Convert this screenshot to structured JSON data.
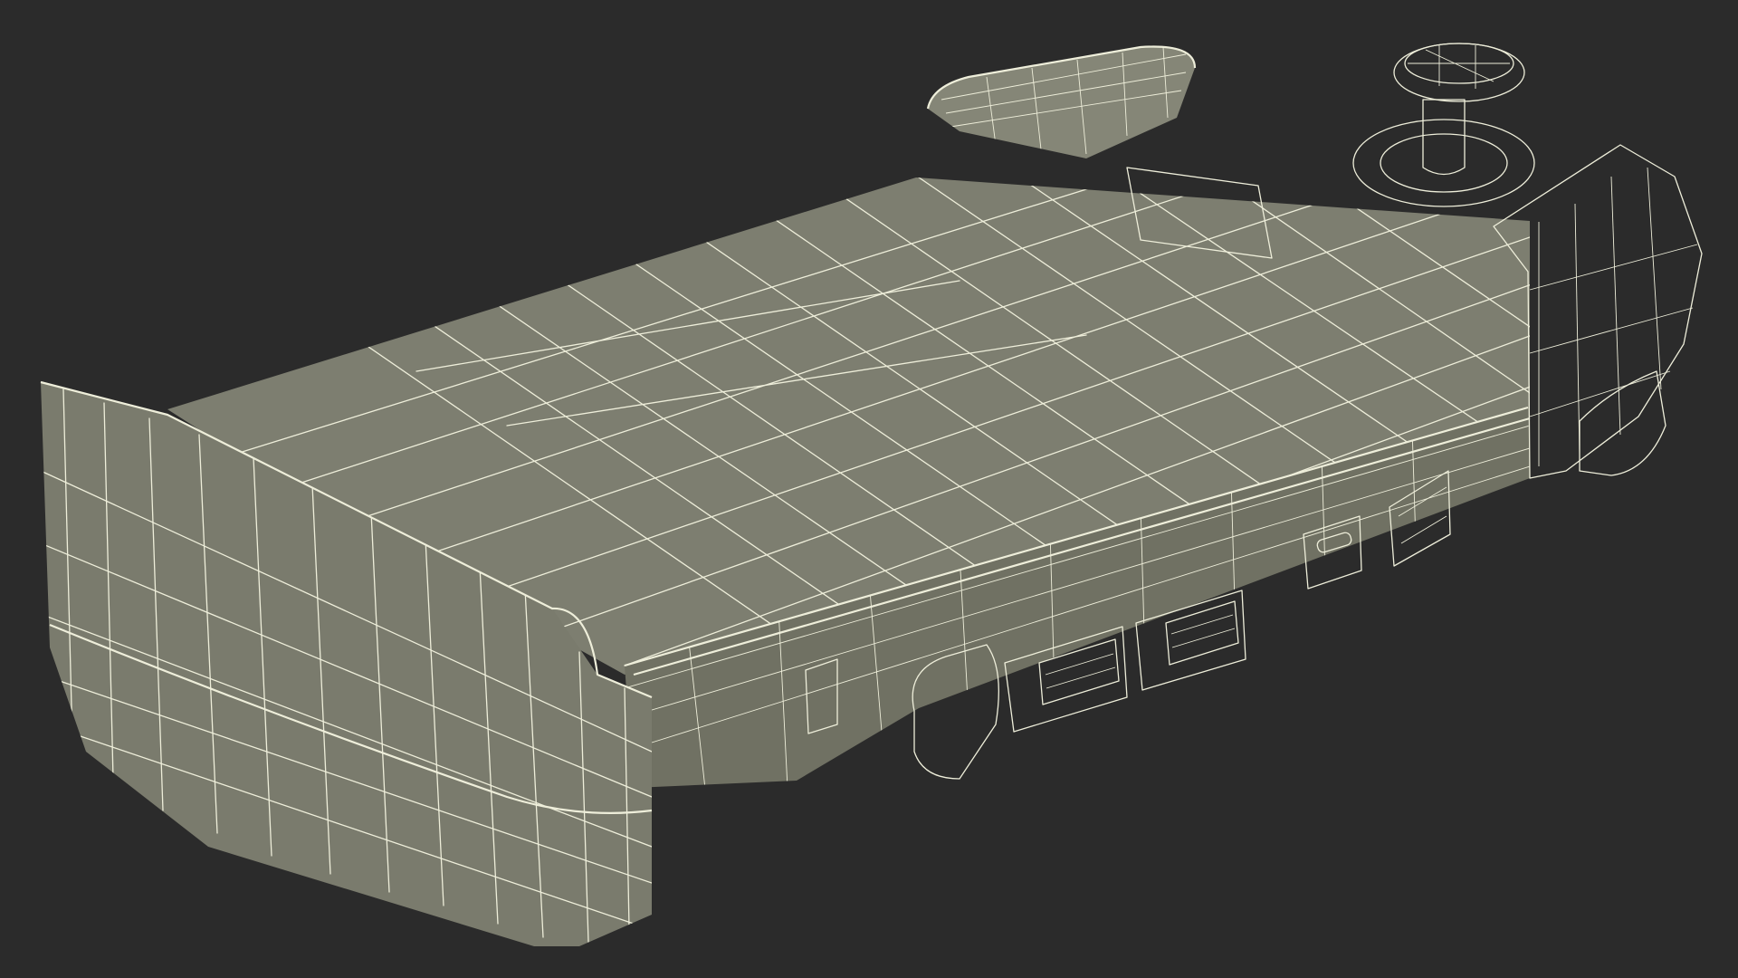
{
  "colors": {
    "background": "#2b2b2b",
    "mesh_fill": "#7d7e70",
    "mesh_fill_dark": "#666759",
    "mesh_fill_light": "#8a8b7c",
    "wire": "#eeeeda"
  }
}
